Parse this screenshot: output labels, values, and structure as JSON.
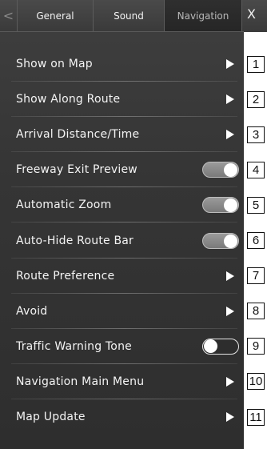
{
  "tabs": {
    "prev_arrow": "<",
    "items": [
      {
        "label": "General"
      },
      {
        "label": "Sound"
      },
      {
        "label": "Navigation",
        "selected": true
      }
    ],
    "close_glyph": "X"
  },
  "rows": [
    {
      "label": "Show on Map",
      "control": "arrow",
      "callout": "1"
    },
    {
      "label": "Show Along Route",
      "control": "arrow",
      "callout": "2"
    },
    {
      "label": "Arrival Distance/Time",
      "control": "arrow",
      "callout": "3"
    },
    {
      "label": "Freeway Exit Preview",
      "control": "toggle",
      "state": "on",
      "callout": "4"
    },
    {
      "label": "Automatic Zoom",
      "control": "toggle",
      "state": "on",
      "callout": "5"
    },
    {
      "label": "Auto-Hide Route Bar",
      "control": "toggle",
      "state": "on",
      "callout": "6"
    },
    {
      "label": "Route Preference",
      "control": "arrow",
      "callout": "7"
    },
    {
      "label": "Avoid",
      "control": "arrow",
      "callout": "8"
    },
    {
      "label": "Traffic Warning Tone",
      "control": "toggle",
      "state": "off",
      "callout": "9"
    },
    {
      "label": "Navigation Main Menu",
      "control": "arrow",
      "callout": "10"
    },
    {
      "label": "Map Update",
      "control": "arrow",
      "callout": "11"
    }
  ],
  "colors": {
    "background": "#353535",
    "text": "#f4f4f4",
    "toggle_on": "#8a8a8a"
  }
}
